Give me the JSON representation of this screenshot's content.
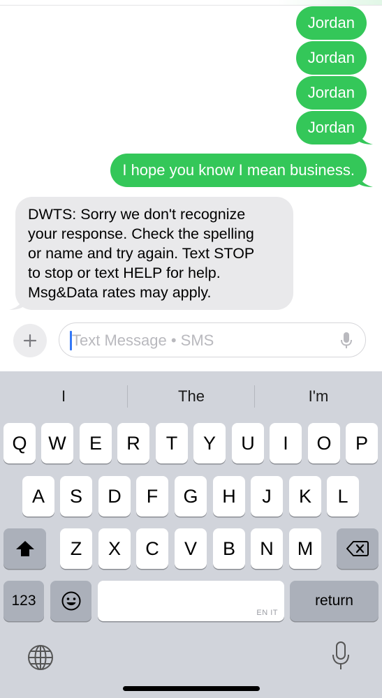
{
  "thread": {
    "outgoing": [
      "Jordan",
      "Jordan",
      "Jordan",
      "Jordan",
      "I hope you know I mean business."
    ],
    "incoming": {
      "lines": [
        "DWTS: Sorry we don't recognize",
        "your response. Check the spelling",
        "or name and try again. Text STOP",
        "to stop or text HELP for help.",
        "Msg&Data rates may apply."
      ]
    }
  },
  "composer": {
    "placeholder": "Text Message • SMS",
    "plus_icon": "plus-icon",
    "dictation_icon": "microphone-icon"
  },
  "keyboard": {
    "suggestions": [
      "I",
      "The",
      "I'm"
    ],
    "row1": [
      "Q",
      "W",
      "E",
      "R",
      "T",
      "Y",
      "U",
      "I",
      "O",
      "P"
    ],
    "row2": [
      "A",
      "S",
      "D",
      "F",
      "G",
      "H",
      "J",
      "K",
      "L"
    ],
    "row3": [
      "Z",
      "X",
      "C",
      "V",
      "B",
      "N",
      "M"
    ],
    "numbers_label": "123",
    "space_language": "EN IT",
    "return_label": "return",
    "shift_icon": "shift-icon",
    "delete_icon": "delete-icon",
    "emoji_icon": "emoji-icon",
    "globe_icon": "globe-icon",
    "mic_icon": "microphone-icon"
  },
  "colors": {
    "outgoing_bubble": "#34c759",
    "incoming_bubble": "#e9e9eb",
    "keyboard_bg": "#d1d4db",
    "caret": "#3478f6"
  }
}
